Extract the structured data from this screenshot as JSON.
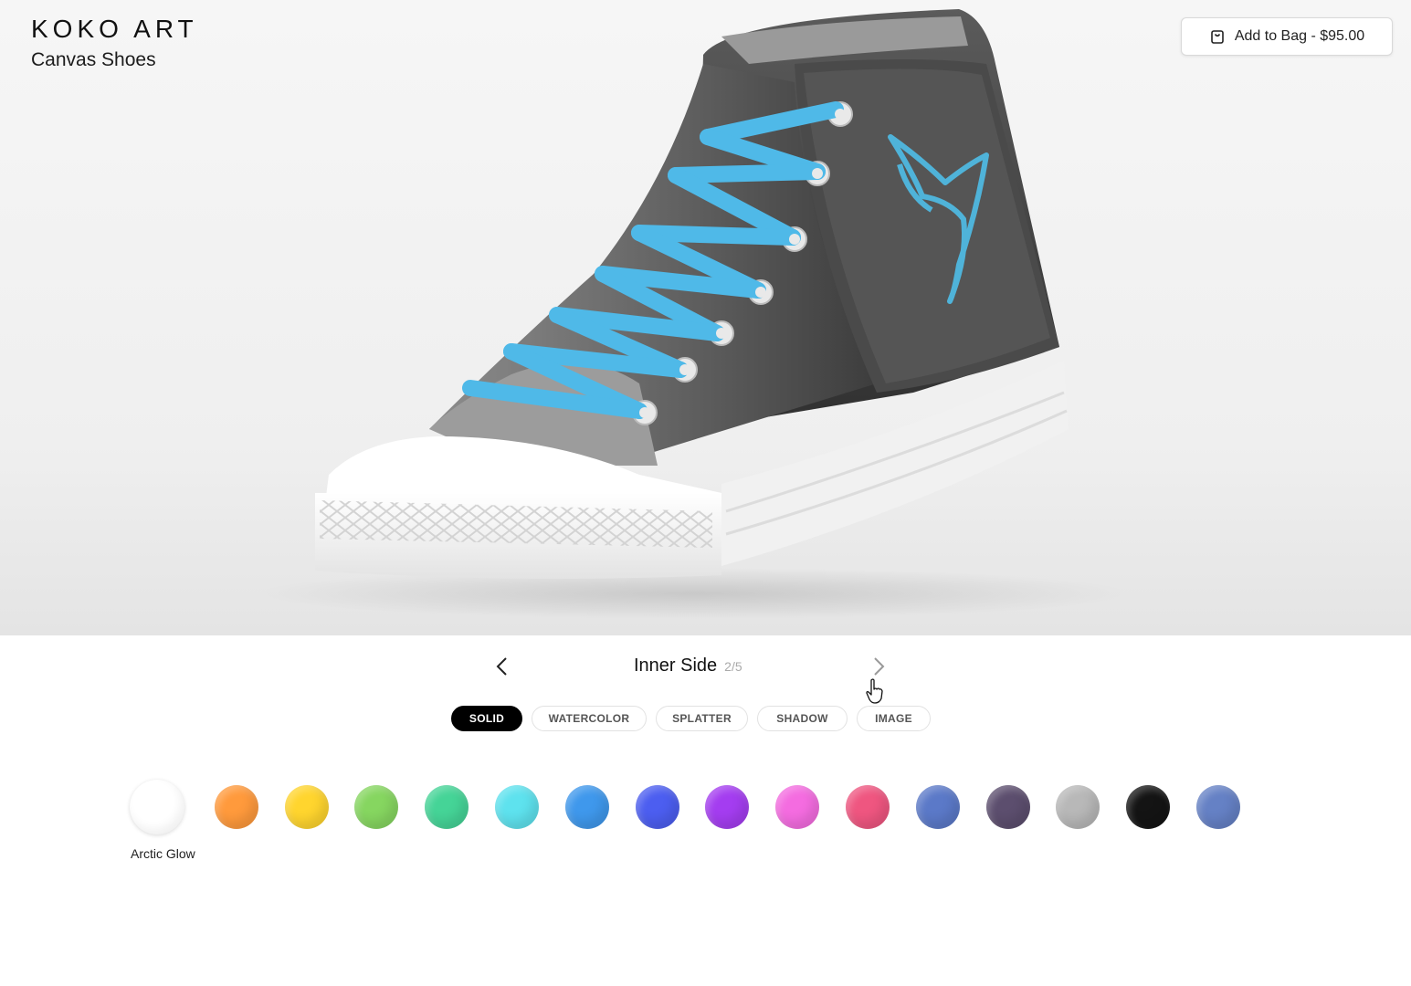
{
  "brand": {
    "logo": "KOKO ART",
    "product": "Canvas Shoes"
  },
  "cart": {
    "button_label": "Add to Bag - $95.00"
  },
  "panel_nav": {
    "title": "Inner Side",
    "counter": "2/5"
  },
  "style_tabs": [
    {
      "label": "SOLID",
      "active": true
    },
    {
      "label": "WATERCOLOR",
      "active": false
    },
    {
      "label": "SPLATTER",
      "active": false
    },
    {
      "label": "SHADOW",
      "active": false
    },
    {
      "label": "IMAGE",
      "active": false
    }
  ],
  "colors": {
    "selected_name": "Arctic Glow",
    "swatches": [
      "#ffffff",
      "#ff9a3c",
      "#ffd52e",
      "#86d660",
      "#45d497",
      "#5ee2ee",
      "#3f98ec",
      "#4c5ef0",
      "#a43df0",
      "#f46ce0",
      "#ef5680",
      "#5b79c8",
      "#5c4e6e",
      "#b8b8b8",
      "#141414",
      "#6581c5"
    ]
  },
  "icons": [
    "bag-icon",
    "chevron-left-icon",
    "chevron-right-icon",
    "hand-cursor-icon"
  ]
}
